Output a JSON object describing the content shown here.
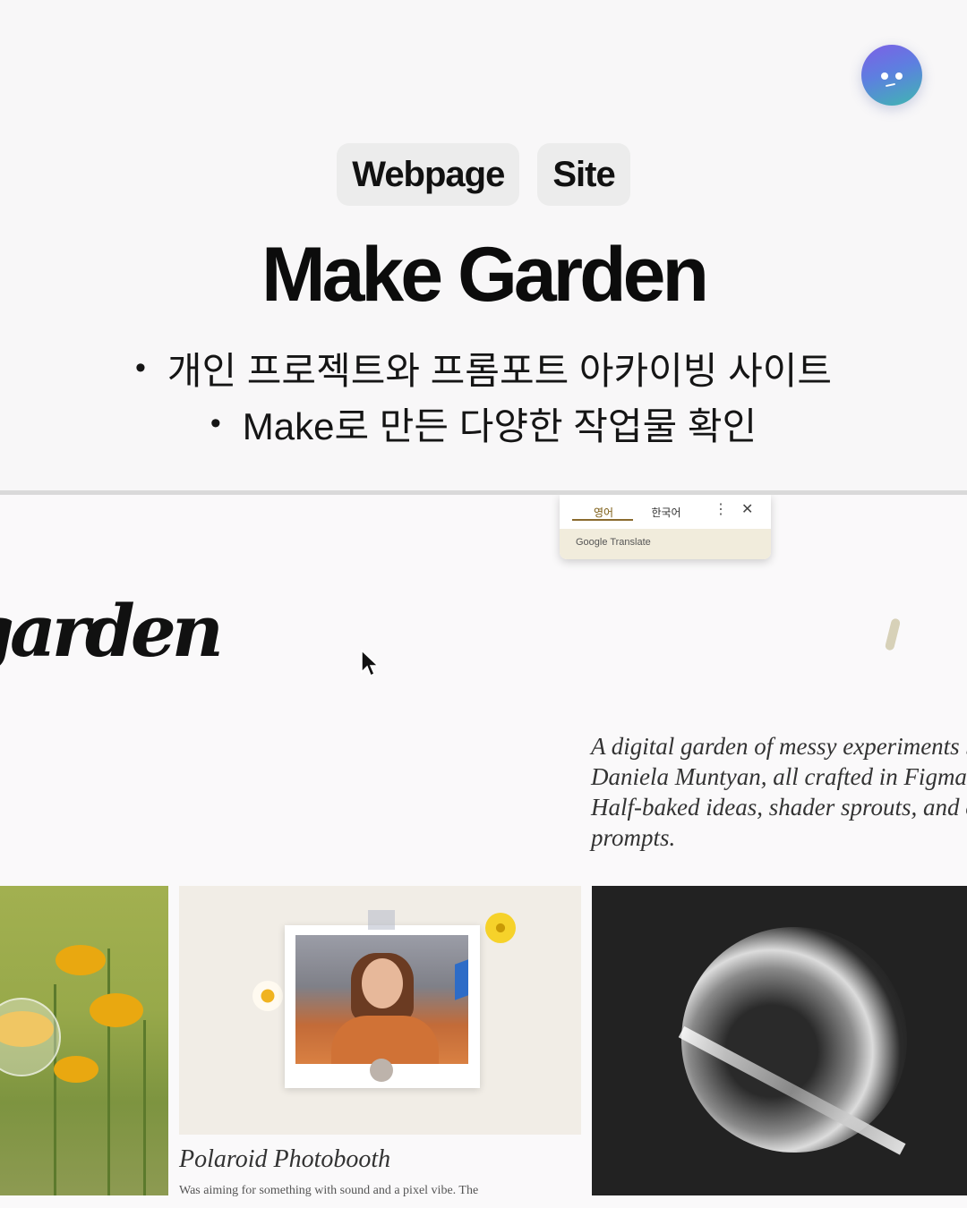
{
  "promo": {
    "tags": [
      "Webpage",
      "Site"
    ],
    "headline": "Make Garden",
    "bullets": [
      "개인 프로젝트와 프롬포트 아카이빙 사이트",
      "Make로 만든 다양한 작업물 확인"
    ]
  },
  "translate_popup": {
    "tab_source": "영어",
    "tab_target": "한국어",
    "more_icon": "⋮",
    "close_icon": "✕",
    "brand": "Google Translate"
  },
  "site": {
    "logo_text": "garden",
    "intro_lines": [
      "A digital garden of messy experiments by",
      "Daniela Muntyan, all crafted in Figma Make.",
      "Half-baked ideas, shader sprouts, and curious",
      "prompts."
    ],
    "cards": [
      {
        "title": "",
        "image": "flowers"
      },
      {
        "title": "Polaroid Photobooth",
        "description": "Was aiming for something with sound and a pixel vibe. The"
      },
      {
        "title": "",
        "image": "shader-orb"
      }
    ]
  }
}
